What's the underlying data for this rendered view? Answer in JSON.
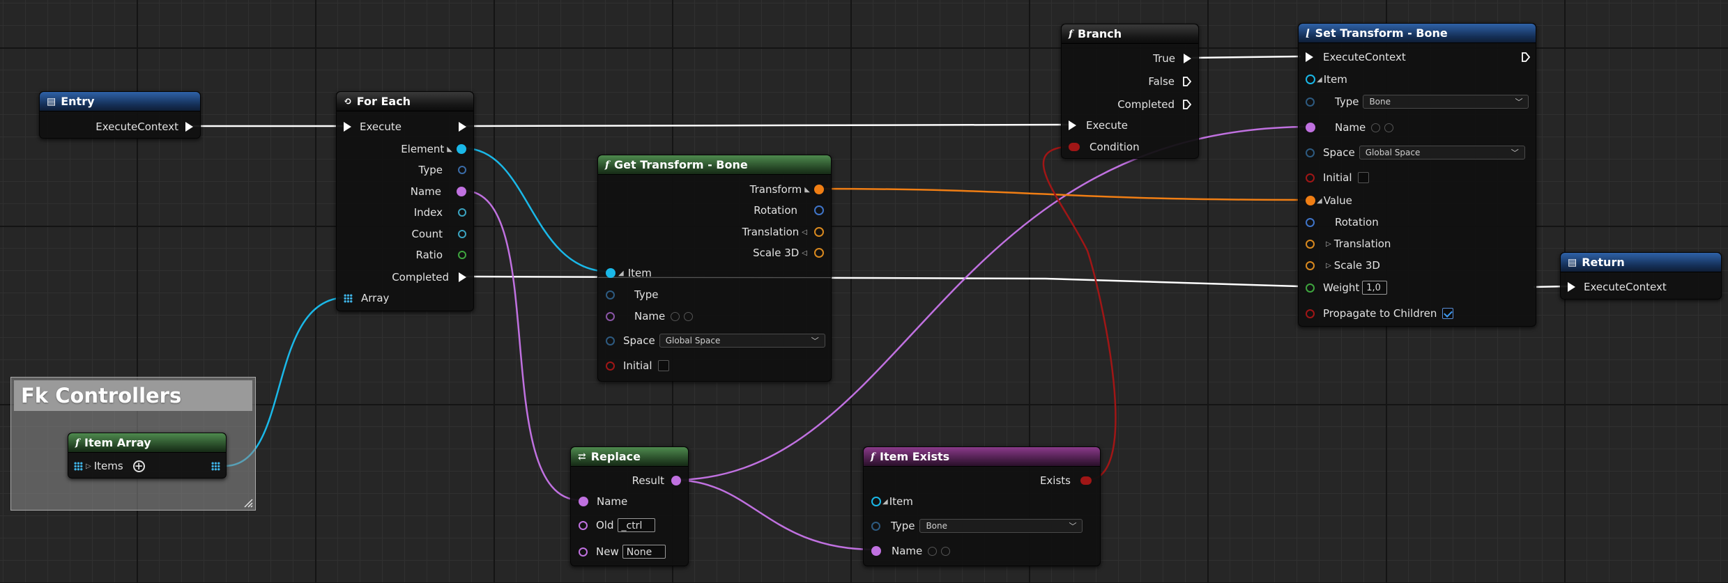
{
  "colors": {
    "exec": "#ffffff",
    "struct_item": "#1ab8e8",
    "name": "#c071e0",
    "transform": "#f07e14",
    "vector": "#d9891f",
    "rotation": "#3f74c8",
    "bool": "#a01616",
    "float": "#3ea53e",
    "int": "#3aa3c0"
  },
  "comment": {
    "title": "Fk Controllers"
  },
  "entry": {
    "title": "Entry",
    "pins": {
      "exec_out": "ExecuteContext"
    }
  },
  "for_each": {
    "title": "For Each",
    "pins": {
      "execute": "Execute",
      "element": "Element",
      "type": "Type",
      "name": "Name",
      "index": "Index",
      "count": "Count",
      "ratio": "Ratio",
      "completed": "Completed",
      "array": "Array"
    }
  },
  "item_array": {
    "title": "Item Array",
    "pins": {
      "items": "Items"
    }
  },
  "get_transform": {
    "title": "Get Transform - Bone",
    "pins": {
      "transform": "Transform",
      "rotation": "Rotation",
      "translation": "Translation",
      "scale": "Scale 3D",
      "item": "Item",
      "type": "Type",
      "name": "Name",
      "space": "Space",
      "initial": "Initial"
    },
    "space_value": "Global Space"
  },
  "replace": {
    "title": "Replace",
    "pins": {
      "result": "Result",
      "name": "Name",
      "old": "Old",
      "new": "New"
    },
    "old_value": "_ctrl",
    "new_value": "None"
  },
  "item_exists": {
    "title": "Item Exists",
    "pins": {
      "exists": "Exists",
      "item": "Item",
      "type": "Type",
      "name": "Name"
    },
    "type_value": "Bone"
  },
  "branch": {
    "title": "Branch",
    "pins": {
      "true": "True",
      "false": "False",
      "completed": "Completed",
      "execute": "Execute",
      "condition": "Condition"
    }
  },
  "set_transform": {
    "title": "Set Transform - Bone",
    "pins": {
      "exec": "ExecuteContext",
      "item": "Item",
      "type": "Type",
      "name": "Name",
      "space": "Space",
      "initial": "Initial",
      "value": "Value",
      "rotation": "Rotation",
      "translation": "Translation",
      "scale": "Scale 3D",
      "weight": "Weight",
      "propagate": "Propagate to Children"
    },
    "type_value": "Bone",
    "space_value": "Global Space",
    "weight_value": "1,0",
    "propagate_checked": true
  },
  "return": {
    "title": "Return",
    "pins": {
      "exec_in": "ExecuteContext"
    }
  }
}
